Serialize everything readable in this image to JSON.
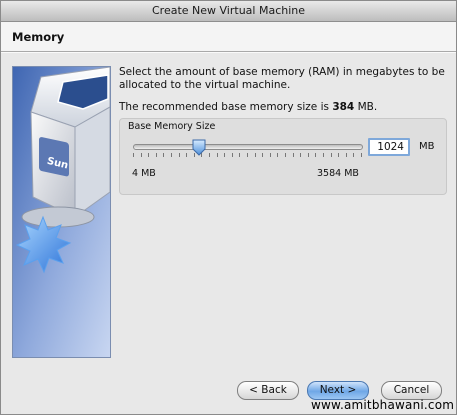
{
  "window": {
    "title": "Create New Virtual Machine"
  },
  "header": {
    "title": "Memory"
  },
  "description": "Select the amount of base memory (RAM) in megabytes to be allocated to the virtual machine.",
  "recommended": {
    "prefix": "The recommended base memory size is ",
    "value": "384",
    "suffix": " MB."
  },
  "memory": {
    "group_label": "Base Memory Size",
    "value": "1024",
    "unit": "MB",
    "min_label": "4 MB",
    "max_label": "3584 MB",
    "slider_fraction": 0.285
  },
  "buttons": {
    "back": "< Back",
    "next": "Next >",
    "cancel": "Cancel"
  },
  "watermark": "www.amitbhawani.com",
  "colors": {
    "accent": "#6fa7e6",
    "sidebar": "#4a6fb8"
  },
  "icons": {
    "sidebar_art": "virtualbox-cube-icon",
    "slider_thumb": "slider-thumb-icon"
  }
}
